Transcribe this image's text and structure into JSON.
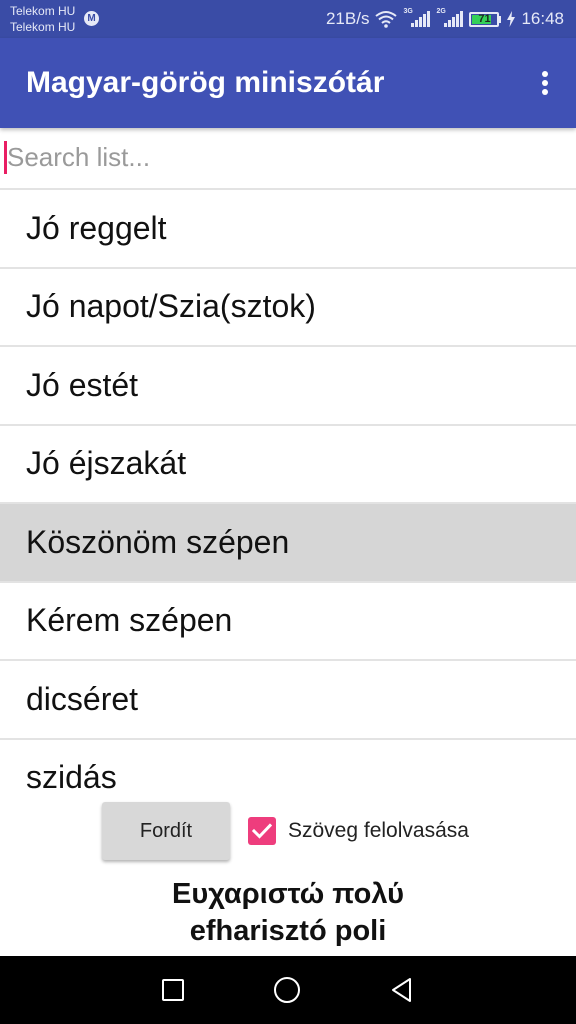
{
  "status_bar": {
    "carrier_1": "Telekom HU",
    "carrier_2": "Telekom HU",
    "carrier_badge": "M",
    "net_speed": "21B/s",
    "sim1_type": "3G",
    "sim2_type": "2G",
    "battery_level": "71",
    "time": "16:48",
    "icons": [
      "wifi-icon",
      "signal-icon",
      "battery-icon",
      "charging-icon"
    ]
  },
  "app_bar": {
    "title": "Magyar-görög miniszótár",
    "menu_icon": "overflow-menu-icon",
    "color": "#4051b5"
  },
  "search": {
    "placeholder": "Search list...",
    "value": ""
  },
  "list": {
    "items": [
      "Jó reggelt",
      "Jó napot/Szia(sztok)",
      "Jó estét",
      "Jó éjszakát",
      "Köszönöm szépen",
      "Kérem szépen",
      "dicséret",
      "szidás"
    ],
    "selected": "Köszönöm szépen"
  },
  "controls": {
    "translate_label": "Fordít",
    "speak_label": "Szöveg felolvasása",
    "speak_checked": true,
    "checkbox_color": "#ee3d7d"
  },
  "result": {
    "greek": "Ευχαριστώ πολύ",
    "transliteration": "efharisztó poli"
  },
  "nav": {
    "icons": [
      "recents-icon",
      "home-icon",
      "back-icon"
    ]
  }
}
